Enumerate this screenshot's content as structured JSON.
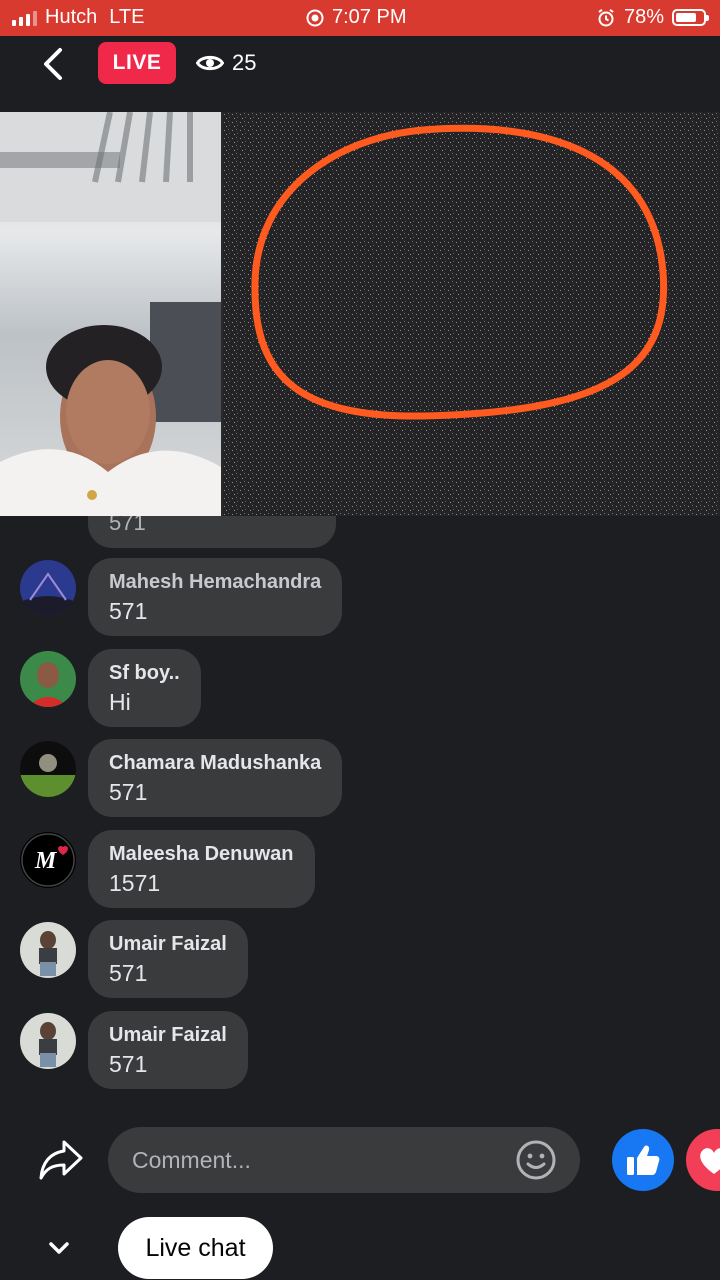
{
  "status_bar": {
    "carrier": "Hutch",
    "network": "LTE",
    "time": "7:07 PM",
    "battery": "78%",
    "battery_level": 0.78
  },
  "header": {
    "live_label": "LIVE",
    "viewer_count": "25",
    "accent_color": "#f02849"
  },
  "chat": {
    "partial_text": "571",
    "messages": [
      {
        "name": "Mahesh Hemachandra",
        "text": "571"
      },
      {
        "name": "Sf boy..",
        "text": "Hi"
      },
      {
        "name": "Chamara Madushanka",
        "text": "571"
      },
      {
        "name": "Maleesha Denuwan",
        "text": "1571"
      },
      {
        "name": "Umair Faizal",
        "text": "571"
      },
      {
        "name": "Umair Faizal",
        "text": "571"
      }
    ]
  },
  "composer": {
    "placeholder": "Comment...",
    "icons": [
      "share-icon",
      "emoji-icon",
      "like-icon",
      "love-icon"
    ]
  },
  "footer": {
    "live_chat_label": "Live chat"
  }
}
